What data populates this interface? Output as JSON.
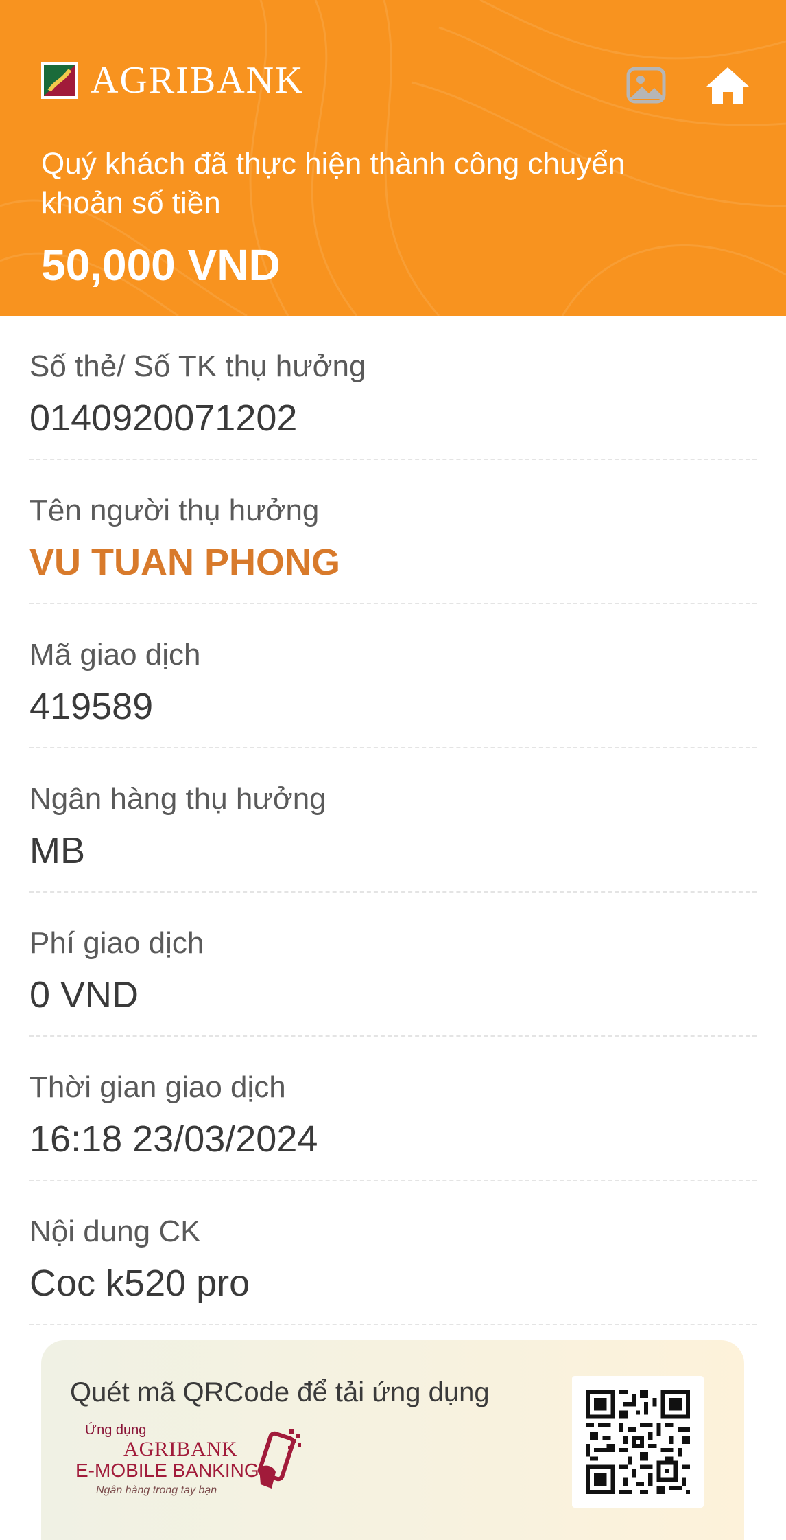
{
  "header": {
    "brand": "AGRIBANK",
    "success_message": "Quý khách đã thực hiện thành công chuyển khoản số tiền",
    "amount": "50,000 VND",
    "gallery_icon": "gallery-icon",
    "home_icon": "home-icon"
  },
  "details": [
    {
      "label": "Số thẻ/ Số TK thụ hưởng",
      "value": "0140920071202"
    },
    {
      "label": "Tên người thụ hưởng",
      "value": "VU TUAN PHONG"
    },
    {
      "label": "Mã giao dịch",
      "value": "419589"
    },
    {
      "label": "Ngân hàng thụ hưởng",
      "value": "MB"
    },
    {
      "label": "Phí giao dịch",
      "value": "0 VND"
    },
    {
      "label": "Thời gian giao dịch",
      "value": "16:18 23/03/2024"
    },
    {
      "label": "Nội dung CK",
      "value": "Coc k520 pro"
    }
  ],
  "promo": {
    "text": "Quét mã QRCode để tải ứng dụng",
    "app_sub": "Ứng dụng",
    "app_name": "AGRIBANK",
    "app_banking": "E-MOBILE BANKING",
    "app_slogan": "Ngân hàng trong tay bạn"
  },
  "colors": {
    "header_bg": "#f8931f",
    "beneficiary_name": "#d87a2b",
    "brand_red": "#a11b3a"
  }
}
